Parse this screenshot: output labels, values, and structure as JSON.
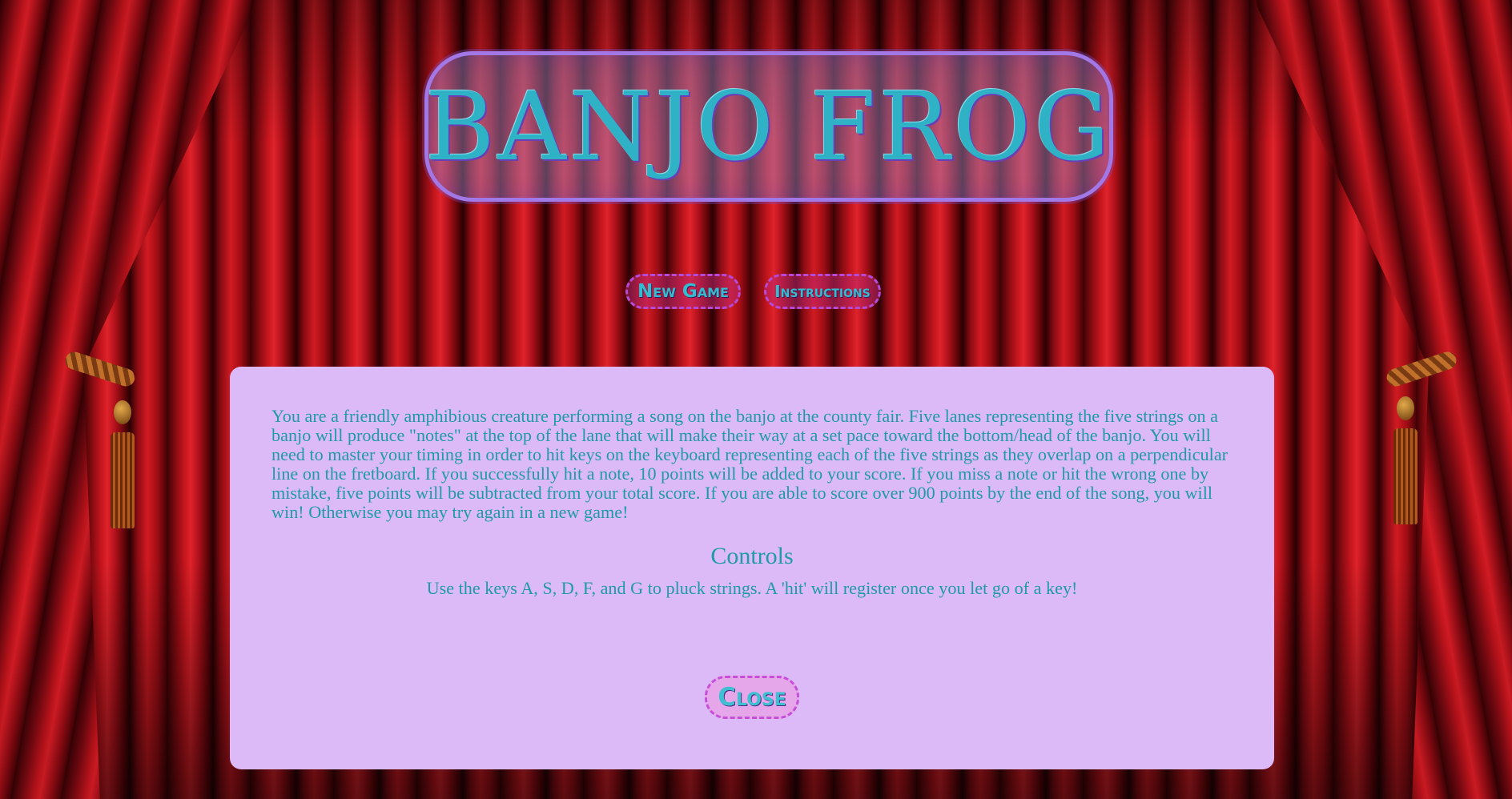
{
  "title": "BANJO FROG",
  "menu": {
    "new_game_label": "New Game",
    "instructions_label": "Instructions"
  },
  "instructions_panel": {
    "body": "You are a friendly amphibious creature performing a song on the banjo at the county fair. Five lanes representing the five strings on a banjo will produce \"notes\" at the top of the lane that will make their way at a set pace toward the bottom/head of the banjo. You will need to master your timing in order to hit keys on the keyboard representing each of the five strings as they overlap on a perpendicular line on the fretboard. If you successfully hit a note, 10 points will be added to your score. If you miss a note or hit the wrong one by mistake, five points will be subtracted from your total score. If you are able to score over 900 points by the end of the song, you will win! Otherwise you may try again in a new game!",
    "controls_heading": "Controls",
    "controls_text": "Use the keys A, S, D, F, and G to pluck strings. A 'hit' will register once you let go of a key!",
    "close_label": "Close"
  },
  "colors": {
    "text_teal": "#1f9aa6",
    "panel_background": "#dcbaf8",
    "curtain_red": "#c4141c",
    "button_border": "#b64ad6"
  }
}
